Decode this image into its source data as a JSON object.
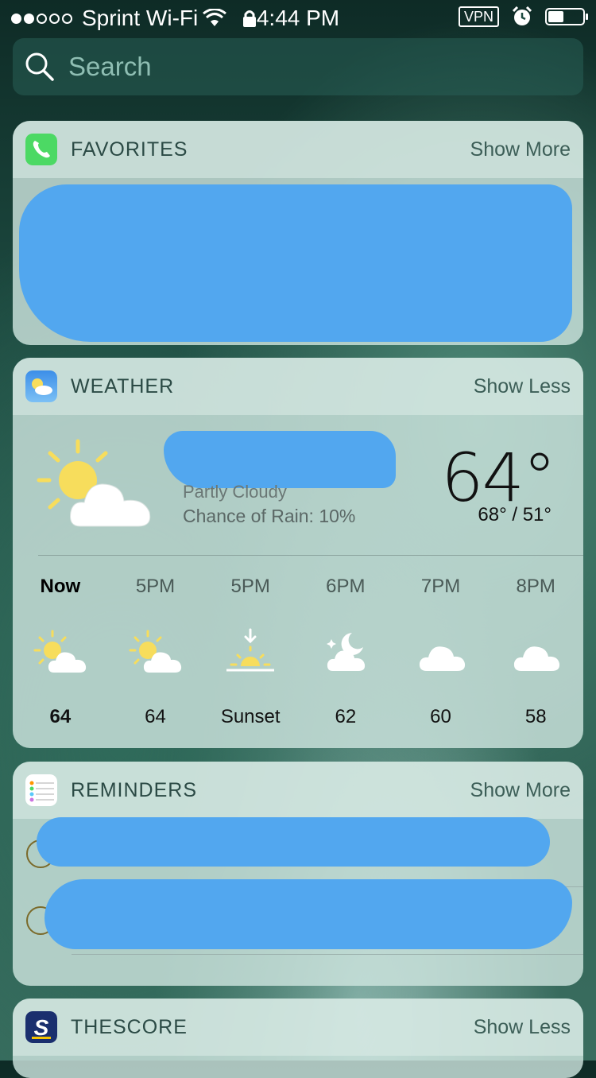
{
  "status_bar": {
    "carrier": "Sprint Wi-Fi",
    "time": "4:44 PM",
    "vpn": "VPN",
    "signal_bars_filled": 2,
    "signal_bars_total": 5,
    "battery_level": 0.45
  },
  "search": {
    "placeholder": "Search"
  },
  "favorites": {
    "title": "FAVORITES",
    "action": "Show More"
  },
  "weather": {
    "title": "WEATHER",
    "action": "Show Less",
    "condition": "Partly Cloudy",
    "rain": "Chance of Rain: 10%",
    "temp": "64°",
    "hilo": "68° / 51°",
    "hours": [
      {
        "label": "Now",
        "icon": "partly-cloudy-icon",
        "value": "64"
      },
      {
        "label": "5PM",
        "icon": "partly-cloudy-icon",
        "value": "64"
      },
      {
        "label": "5PM",
        "icon": "sunset-icon",
        "value": "Sunset"
      },
      {
        "label": "6PM",
        "icon": "partly-cloudy-night-icon",
        "value": "62"
      },
      {
        "label": "7PM",
        "icon": "cloud-icon",
        "value": "60"
      },
      {
        "label": "8PM",
        "icon": "cloud-icon",
        "value": "58"
      }
    ]
  },
  "reminders": {
    "title": "REMINDERS",
    "action": "Show More"
  },
  "thescore": {
    "title": "THESCORE",
    "action": "Show Less"
  },
  "colors": {
    "redaction": "#52a7ef",
    "sun": "#f7dd5c",
    "phone_green": "#4cd964"
  }
}
